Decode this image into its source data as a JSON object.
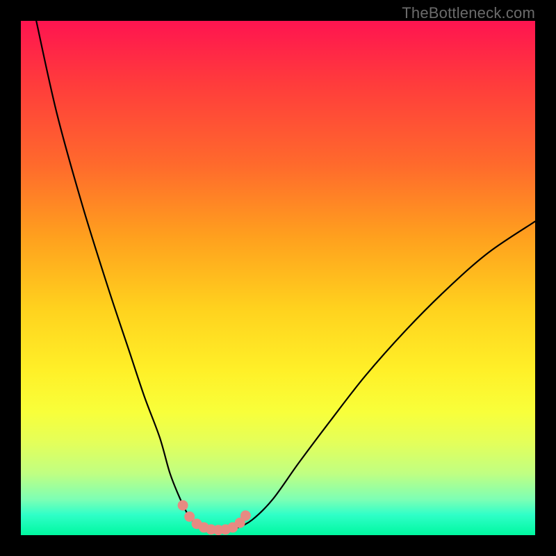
{
  "attribution": "TheBottleneck.com",
  "chart_data": {
    "type": "line",
    "title": "",
    "xlabel": "",
    "ylabel": "",
    "xlim": [
      0,
      100
    ],
    "ylim": [
      0,
      100
    ],
    "series": [
      {
        "name": "curve",
        "x": [
          3,
          7,
          12,
          17,
          21,
          24,
          27,
          29,
          31,
          32.5,
          34,
          36,
          38,
          40,
          42,
          45,
          49,
          54,
          60,
          67,
          75,
          83,
          91,
          100
        ],
        "values": [
          100,
          82,
          64,
          48,
          36,
          27,
          19,
          12,
          7,
          4,
          2.2,
          1.2,
          1.0,
          1.0,
          1.4,
          3,
          7,
          14,
          22,
          31,
          40,
          48,
          55,
          61
        ]
      }
    ],
    "markers": {
      "name": "highlight-dots",
      "color": "#e78a82",
      "x": [
        31.5,
        32.8,
        34.2,
        35.6,
        37.0,
        38.4,
        39.8,
        41.2,
        42.6,
        43.7
      ],
      "values": [
        5.8,
        3.6,
        2.2,
        1.5,
        1.1,
        1.0,
        1.1,
        1.5,
        2.4,
        3.8
      ]
    }
  }
}
